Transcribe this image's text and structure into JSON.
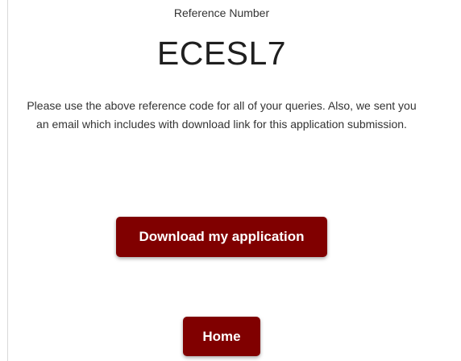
{
  "reference": {
    "label": "Reference Number",
    "code": "ECESL7"
  },
  "message": {
    "text": "Please use the above reference code for all of your queries. Also, we sent you an email which includes with download link for this application submission."
  },
  "actions": {
    "download_label": "Download my application",
    "home_label": "Home"
  },
  "colors": {
    "button_background": "#800000",
    "button_text": "#ffffff"
  }
}
